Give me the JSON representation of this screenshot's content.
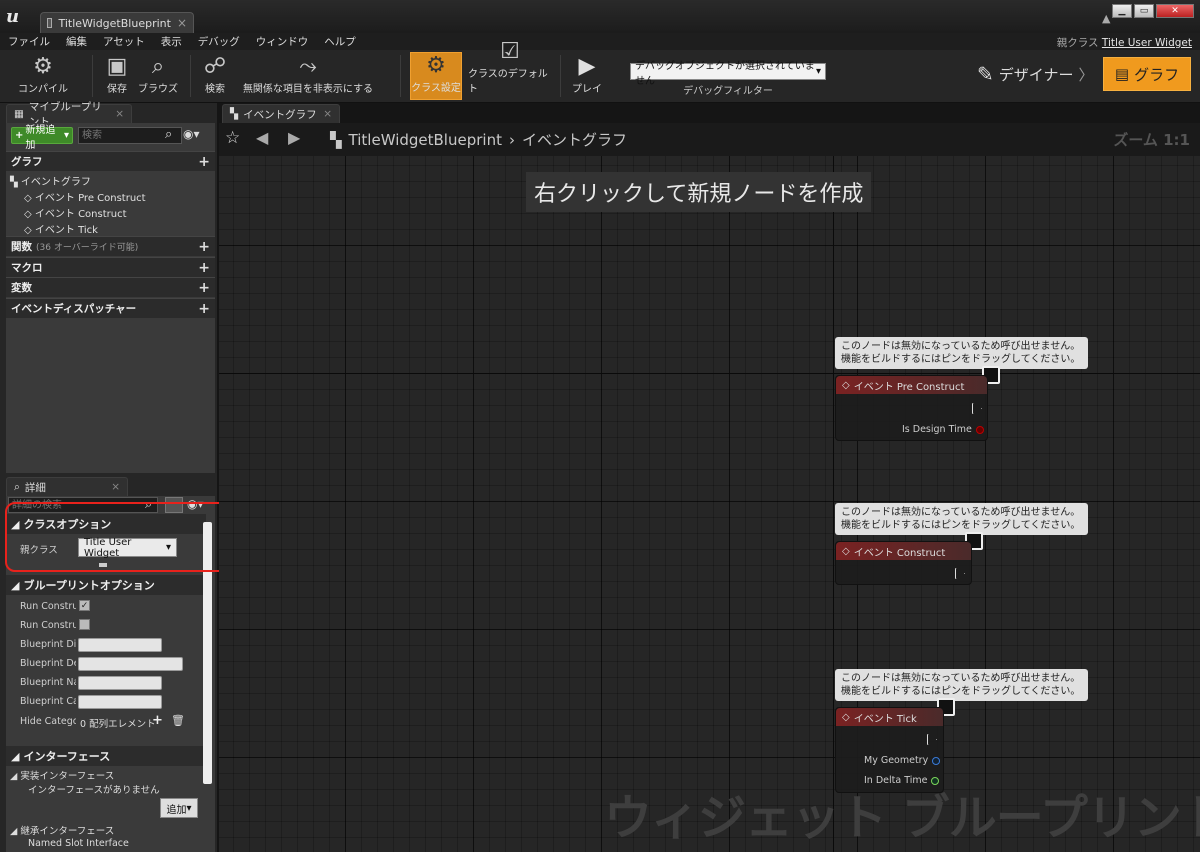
{
  "window": {
    "tab_title": "TitleWidgetBlueprint",
    "parent_class_label": "親クラス",
    "parent_class_value": "Title User Widget"
  },
  "menu": [
    "ファイル",
    "編集",
    "アセット",
    "表示",
    "デバッグ",
    "ウィンドウ",
    "ヘルプ"
  ],
  "toolbar": {
    "compile": "コンパイル",
    "save": "保存",
    "browse": "ブラウズ",
    "find": "検索",
    "hide_unrelated": "無関係な項目を非表示にする",
    "class_settings": "クラス設定",
    "class_defaults": "クラスのデフォルト",
    "play": "プレイ",
    "debug_object": "デバッグオブジェクトが選択されていません",
    "debug_filter": "デバッグフィルター",
    "designer": "デザイナー",
    "graph": "グラフ"
  },
  "my_blueprint": {
    "tab": "マイブループリント",
    "add_new": "新規追加",
    "search_placeholder": "検索",
    "graph_section": "グラフ",
    "event_graph": "イベントグラフ",
    "events": [
      "イベント Pre Construct",
      "イベント Construct",
      "イベント Tick"
    ],
    "functions": "関数",
    "functions_note": "(36 オーバーライド可能)",
    "macros": "マクロ",
    "variables": "変数",
    "dispatchers": "イベントディスパッチャー"
  },
  "details": {
    "tab": "詳細",
    "search_placeholder": "詳細の検索",
    "class_options": "クラスオプション",
    "parent_class": "親クラス",
    "parent_class_value": "Title User Widget",
    "bp_options": "ブループリントオプション",
    "rows": [
      "Run Construct",
      "Run Construct",
      "Blueprint Disp",
      "Blueprint Desc",
      "Blueprint Nam",
      "Blueprint Cate",
      "Hide Categori"
    ],
    "array_elements": "0 配列エレメント",
    "interfaces": "インターフェース",
    "implemented": "実装インターフェース",
    "no_interfaces": "インターフェースがありません",
    "add": "追加",
    "inherited": "継承インターフェース",
    "named_slot": "Named Slot Interface"
  },
  "graph": {
    "tab": "イベントグラフ",
    "breadcrumb_bp": "TitleWidgetBlueprint",
    "breadcrumb_graph": "イベントグラフ",
    "zoom": "ズーム 1:1",
    "hint": "右クリックして新規ノードを作成",
    "comment": "このノードは無効になっているため呼び出せません。機能をビルドするにはピンをドラッグしてください。",
    "nodes": [
      {
        "title": "イベント Pre Construct",
        "pins": [
          "Is Design Time"
        ]
      },
      {
        "title": "イベント Construct",
        "pins": []
      },
      {
        "title": "イベント Tick",
        "pins": [
          "My Geometry",
          "In Delta Time"
        ]
      }
    ],
    "watermark": "ウィジェット ブループリント"
  },
  "colors": {
    "accent": "#f09a1e",
    "event_header": "#7a2222",
    "highlight": "#e8221c",
    "add_green": "#3e8a28"
  }
}
